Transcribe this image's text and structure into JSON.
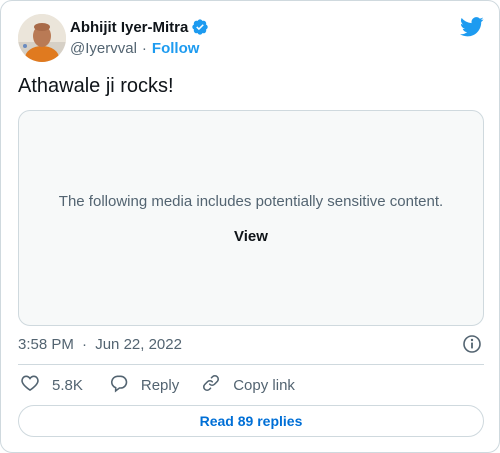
{
  "author": {
    "display_name": "Abhijit Iyer-Mitra",
    "handle": "@Iyervval",
    "separator": "·",
    "follow_label": "Follow",
    "verified": true
  },
  "tweet": {
    "text": "Athawale ji rocks!"
  },
  "media": {
    "warning_text": "The following media includes potentially sensitive content.",
    "view_label": "View"
  },
  "meta": {
    "time": "3:58 PM",
    "separator": "·",
    "date": "Jun 22, 2022"
  },
  "actions": {
    "like_count": "5.8K",
    "reply_label": "Reply",
    "copy_label": "Copy link"
  },
  "read_replies_label": "Read 89 replies",
  "colors": {
    "accent": "#1d9bf0",
    "link": "#006fd6",
    "secondary_text": "#536471",
    "border": "#cfd9de",
    "media_bg": "#f7f9f9"
  },
  "icons": {
    "logo": "twitter-bird-icon",
    "verified": "verified-badge-icon",
    "info": "info-icon",
    "like": "heart-icon",
    "reply": "speech-bubble-icon",
    "copy": "link-chain-icon"
  }
}
